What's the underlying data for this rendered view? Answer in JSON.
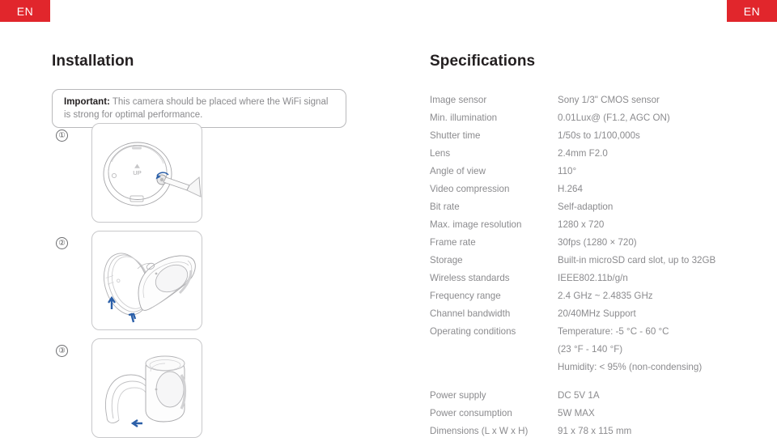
{
  "language_badge": {
    "label": "EN"
  },
  "installation": {
    "heading": "Installation",
    "callout": {
      "lead": "Important:",
      "text": " This camera should be placed where the WiFi signal is strong for optimal performance."
    },
    "steps": [
      {
        "number": "①",
        "figure_name": "camera-base-screwdriver-illustration"
      },
      {
        "number": "②",
        "figure_name": "camera-body-mount-tilt-illustration"
      },
      {
        "number": "③",
        "figure_name": "camera-body-upright-illustration"
      }
    ],
    "figure_labels": {
      "up_label": "UP"
    }
  },
  "specifications": {
    "heading": "Specifications",
    "rows": [
      {
        "label": "Image sensor",
        "values": [
          "Sony 1/3\" CMOS sensor"
        ]
      },
      {
        "label": "Min. illumination",
        "values": [
          "0.01Lux@ (F1.2, AGC ON)"
        ]
      },
      {
        "label": "Shutter time",
        "values": [
          "1/50s to 1/100,000s"
        ]
      },
      {
        "label": "Lens",
        "values": [
          "2.4mm F2.0"
        ]
      },
      {
        "label": "Angle of view",
        "values": [
          "110°"
        ]
      },
      {
        "label": "Video compression",
        "values": [
          "H.264"
        ]
      },
      {
        "label": "Bit rate",
        "values": [
          "Self-adaption"
        ]
      },
      {
        "label": "Max. image resolution",
        "values": [
          "1280 x 720"
        ]
      },
      {
        "label": "Frame rate",
        "values": [
          "30fps (1280 × 720)"
        ]
      },
      {
        "label": "Storage",
        "values": [
          "Built-in microSD card slot, up to 32GB"
        ]
      },
      {
        "label": "Wireless standards",
        "values": [
          "IEEE802.11b/g/n"
        ]
      },
      {
        "label": "Frequency range",
        "values": [
          "2.4 GHz ~ 2.4835 GHz"
        ]
      },
      {
        "label": "Channel bandwidth",
        "values": [
          "20/40MHz Support"
        ]
      },
      {
        "label": "Operating conditions",
        "values": [
          "Temperature: -5 °C - 60 °C",
          "(23 °F - 140 °F)",
          "Humidity: < 95% (non-condensing)"
        ]
      },
      {
        "label": "Power supply",
        "values": [
          "DC 5V 1A"
        ],
        "spaced": true
      },
      {
        "label": "Power consumption",
        "values": [
          "5W MAX"
        ]
      },
      {
        "label": "Dimensions (L x W x H)",
        "values": [
          "91 x 78 x 115 mm"
        ]
      }
    ]
  },
  "colors": {
    "badge_background": "#e1262c",
    "badge_text": "#ffffff",
    "heading_text": "#231f20",
    "body_text": "#8b8b8e",
    "line_art": "#9a9a9d",
    "arrow_accent": "#2b5fa8"
  }
}
